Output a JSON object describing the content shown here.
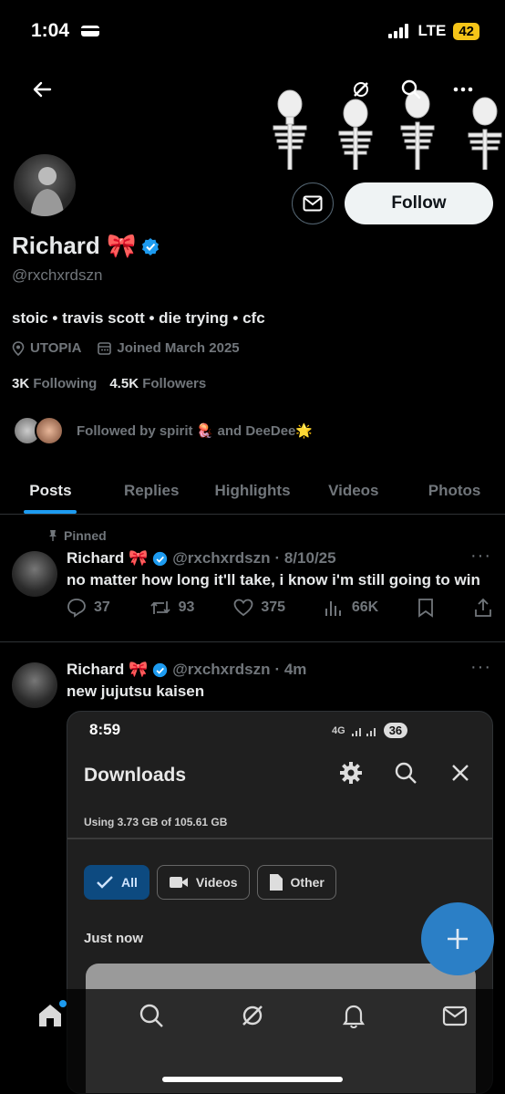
{
  "status": {
    "time": "1:04",
    "network": "LTE",
    "battery": "42"
  },
  "profile": {
    "name": "Richard 🎀",
    "handle": "@rxchxrdszn",
    "bio": "stoic • travis scott • die trying • cfc",
    "location": "UTOPIA",
    "joined": "Joined March 2025",
    "following_count": "3K",
    "following_label": "Following",
    "followers_count": "4.5K",
    "followers_label": "Followers",
    "followed_by": "Followed by spirit 🪼 and DeeDee🌟",
    "follow_label": "Follow"
  },
  "tabs": [
    "Posts",
    "Replies",
    "Highlights",
    "Videos",
    "Photos"
  ],
  "posts": [
    {
      "pinned_label": "Pinned",
      "name": "Richard 🎀",
      "handle": "@rxchxrdszn",
      "time": "· 8/10/25",
      "text": "no matter how long it'll take, i know i'm still going to win",
      "replies": "37",
      "reposts": "93",
      "likes": "375",
      "views": "66K"
    },
    {
      "name": "Richard 🎀",
      "handle": "@rxchxrdszn",
      "time": "· 4m",
      "text": "new jujutsu kaisen"
    }
  ],
  "media": {
    "time": "8:59",
    "signal": "4G",
    "battery": "36",
    "title": "Downloads",
    "usage": "Using 3.73 GB of 105.61 GB",
    "chips": [
      "All",
      "Videos",
      "Other"
    ],
    "section": "Just now"
  },
  "colors": {
    "accent": "#1d9bf0",
    "background": "#000000",
    "muted": "#71767b"
  }
}
